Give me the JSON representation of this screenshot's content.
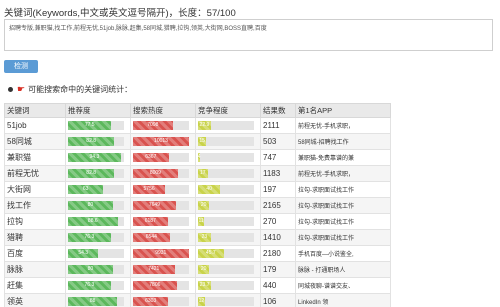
{
  "keywords": {
    "title": "关键词(Keywords,中文或英文逗号隔开)，长度：57/100",
    "input_value": "招聘专版,兼职猫,找工作,前程无忧,51job,脉脉,赶集,58同城,猎聘,拉钩,领英,大街网,BOSS直聘,百度"
  },
  "detect_button": "检测",
  "stat_label": "可能搜索命中的关键词统计：",
  "table": {
    "headers": [
      "关键词",
      "推荐度",
      "搜索热度",
      "竞争程度",
      "结果数",
      "第1名APP"
    ],
    "rows": [
      {
        "keyword": "51job",
        "rec": 77.5,
        "heat": 7098,
        "comp": 22.9,
        "results": "2111",
        "app": "前程无忧-手机求职，"
      },
      {
        "keyword": "58同城",
        "rec": 82.8,
        "heat": 10013,
        "comp": 15.0,
        "results": "503",
        "app": "58同城-招聘找工作"
      },
      {
        "keyword": "兼职猫",
        "rec": 94.3,
        "heat": 6367,
        "comp": 4.0,
        "results": "747",
        "app": "兼职猫-免费靠谱的兼"
      },
      {
        "keyword": "前程无忧",
        "rec": 82.8,
        "heat": 8009,
        "comp": 17.0,
        "results": "1183",
        "app": "前程无忧-手机求职，"
      },
      {
        "keyword": "大街网",
        "rec": 63.0,
        "heat": 5756,
        "comp": 40.0,
        "results": "197",
        "app": "拉勾-求职面试找工作"
      },
      {
        "keyword": "找工作",
        "rec": 80.0,
        "heat": 7649,
        "comp": 20.0,
        "results": "2165",
        "app": "拉勾-求职面试找工作"
      },
      {
        "keyword": "拉钩",
        "rec": 88.6,
        "heat": 6187,
        "comp": 11.0,
        "results": "270",
        "app": "拉勾-求职面试找工作"
      },
      {
        "keyword": "猎聘",
        "rec": 76.3,
        "heat": 6544,
        "comp": 23.0,
        "results": "1410",
        "app": "拉勾-求职面试找工作"
      },
      {
        "keyword": "百度",
        "rec": 54.3,
        "heat": 9931,
        "comp": 45.7,
        "results": "2180",
        "app": "手机百度—小说鉴全,"
      },
      {
        "keyword": "脉脉",
        "rec": 80.0,
        "heat": 7421,
        "comp": 20.0,
        "results": "179",
        "app": "脉脉 - 打通职场人"
      },
      {
        "keyword": "赶集",
        "rec": 76.3,
        "heat": 7806,
        "comp": 23.7,
        "results": "440",
        "app": "同城夜聊-谱谱交友、"
      },
      {
        "keyword": "领英",
        "rec": 88.0,
        "heat": 6303,
        "comp": 12.0,
        "results": "106",
        "app": "LinkedIn 领"
      }
    ]
  }
}
